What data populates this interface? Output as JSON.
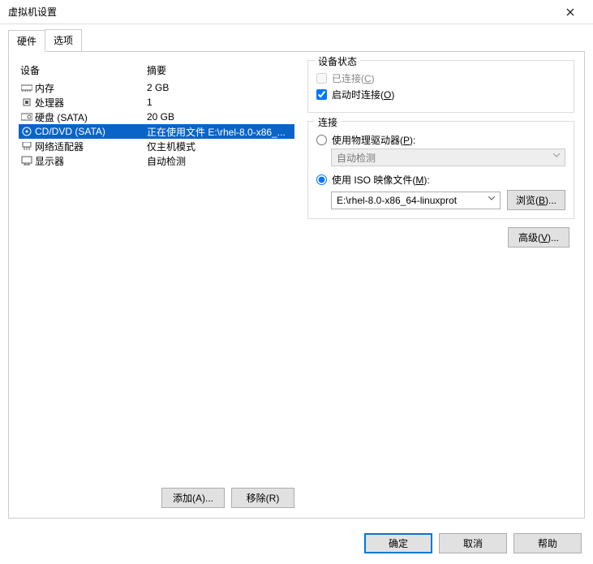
{
  "window": {
    "title": "虚拟机设置"
  },
  "tabs": {
    "hardware": "硬件",
    "options": "选项"
  },
  "table": {
    "header_device": "设备",
    "header_summary": "摘要",
    "rows": [
      {
        "icon": "memory",
        "name": "内存",
        "summary": "2 GB"
      },
      {
        "icon": "cpu",
        "name": "处理器",
        "summary": "1"
      },
      {
        "icon": "disk",
        "name": "硬盘 (SATA)",
        "summary": "20 GB"
      },
      {
        "icon": "cd",
        "name": "CD/DVD (SATA)",
        "summary": "正在使用文件 E:\\rhel-8.0-x86_...",
        "selected": true
      },
      {
        "icon": "net",
        "name": "网络适配器",
        "summary": "仅主机模式"
      },
      {
        "icon": "monitor",
        "name": "显示器",
        "summary": "自动检测"
      }
    ]
  },
  "left_buttons": {
    "add": "添加(A)...",
    "remove": "移除(R)"
  },
  "device_status": {
    "legend": "设备状态",
    "connected": "已连接(C)",
    "connect_at_poweron": "启动时连接(O)"
  },
  "connection": {
    "legend": "连接",
    "use_physical": "使用物理驱动器(P):",
    "autodetect": "自动检测",
    "use_iso": "使用 ISO 映像文件(M):",
    "iso_path": "E:\\rhel-8.0-x86_64-linuxprot",
    "browse": "浏览(B)..."
  },
  "advanced": "高级(V)...",
  "footer": {
    "ok": "确定",
    "cancel": "取消",
    "help": "帮助"
  }
}
